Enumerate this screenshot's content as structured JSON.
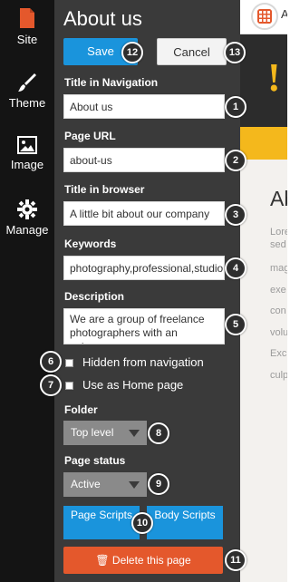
{
  "sidebar": {
    "items": [
      {
        "label": "Site",
        "icon": "page-icon",
        "color": "#e4582c"
      },
      {
        "label": "Theme",
        "icon": "brush-icon",
        "color": "#ffffff"
      },
      {
        "label": "Image",
        "icon": "image-icon",
        "color": "#ffffff"
      },
      {
        "label": "Manage",
        "icon": "gear-icon",
        "color": "#ffffff"
      }
    ]
  },
  "panel": {
    "title": "About us",
    "save_label": "Save",
    "cancel_label": "Cancel",
    "fields": {
      "nav_title_label": "Title in Navigation",
      "nav_title_value": "About us",
      "url_label": "Page URL",
      "url_value": "about-us",
      "browser_title_label": "Title in browser",
      "browser_title_value": "A little bit about our company",
      "keywords_label": "Keywords",
      "keywords_value": "photography,professional,studio",
      "description_label": "Description",
      "description_value": "We are a group of freelance photographers with an extense"
    },
    "checkboxes": {
      "hidden_label": "Hidden from navigation",
      "home_label": "Use as Home page"
    },
    "folder_label": "Folder",
    "folder_value": "Top level",
    "status_label": "Page status",
    "status_value": "Active",
    "page_scripts_label": "Page Scripts",
    "body_scripts_label": "Body Scripts",
    "delete_label": "Delete this page"
  },
  "callouts": [
    "1",
    "2",
    "3",
    "4",
    "5",
    "6",
    "7",
    "8",
    "9",
    "10",
    "11",
    "12",
    "13"
  ],
  "preview": {
    "top_letter": "A",
    "heading": "Ab",
    "lines": [
      "Lore",
      "sed",
      "mag",
      "exe",
      "con",
      "volu",
      "Exc",
      "culp"
    ]
  },
  "colors": {
    "accent_blue": "#1a94dc",
    "delete_orange": "#e4582c",
    "hero_yellow": "#f4b81c"
  }
}
